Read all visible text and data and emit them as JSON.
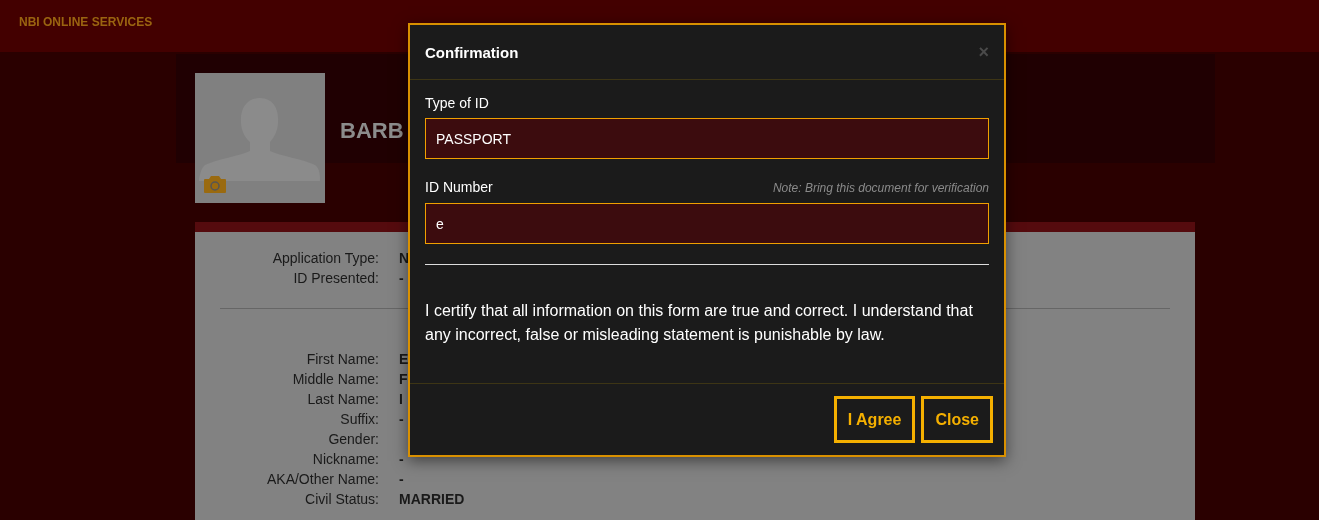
{
  "header": {
    "brand": "NBI ONLINE SERVICES"
  },
  "profile": {
    "name": "BARB"
  },
  "application": [
    {
      "label": "Application Type:",
      "value": "N"
    },
    {
      "label": "ID Presented:",
      "value": "-"
    }
  ],
  "personal": [
    {
      "label": "First Name:",
      "value": "E"
    },
    {
      "label": "Middle Name:",
      "value": "F"
    },
    {
      "label": "Last Name:",
      "value": "I"
    },
    {
      "label": "Suffix:",
      "value": "-"
    },
    {
      "label": "Gender:"
    },
    {
      "label": "Nickname:",
      "value": "-"
    },
    {
      "label": "AKA/Other Name:",
      "value": "-"
    },
    {
      "label": "Civil Status:",
      "value": "MARRIED"
    }
  ],
  "modal": {
    "title": "Confirmation",
    "close_glyph": "×",
    "fields": [
      {
        "label": "Type of ID",
        "value": "PASSPORT"
      },
      {
        "label": "ID Number",
        "note": "Note: Bring this document for verification",
        "value": "e"
      }
    ],
    "statement": "I certify that all information on this form are true and correct. I understand that any incorrect, false or misleading statement is punishable by law.",
    "buttons": [
      "I Agree",
      "Close"
    ]
  }
}
